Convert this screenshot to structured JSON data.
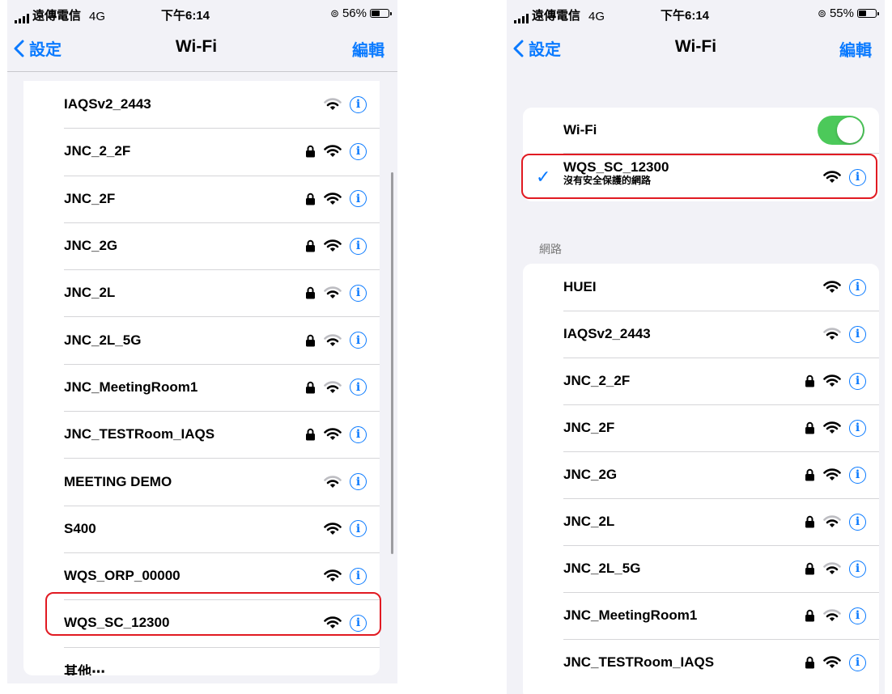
{
  "left": {
    "status": {
      "carrier": "遠傳電信",
      "network": "4G",
      "time": "下午6:14",
      "battery": "56%",
      "battery_level": 0.56
    },
    "nav": {
      "back": "設定",
      "title": "Wi-Fi",
      "edit": "編輯"
    },
    "networks": [
      {
        "name": "IAQSv2_2443",
        "locked": false,
        "signal": "medium"
      },
      {
        "name": "JNC_2_2F",
        "locked": true,
        "signal": "strong"
      },
      {
        "name": "JNC_2F",
        "locked": true,
        "signal": "strong"
      },
      {
        "name": "JNC_2G",
        "locked": true,
        "signal": "strong"
      },
      {
        "name": "JNC_2L",
        "locked": true,
        "signal": "medium"
      },
      {
        "name": "JNC_2L_5G",
        "locked": true,
        "signal": "medium"
      },
      {
        "name": "JNC_MeetingRoom1",
        "locked": true,
        "signal": "medium"
      },
      {
        "name": "JNC_TESTRoom_IAQS",
        "locked": true,
        "signal": "strong"
      },
      {
        "name": "MEETING DEMO",
        "locked": false,
        "signal": "medium"
      },
      {
        "name": "S400",
        "locked": false,
        "signal": "strong"
      },
      {
        "name": "WQS_ORP_00000",
        "locked": false,
        "signal": "strong"
      },
      {
        "name": "WQS_SC_12300",
        "locked": false,
        "signal": "strong"
      }
    ],
    "other": "其他⋯"
  },
  "right": {
    "status": {
      "carrier": "遠傳電信",
      "network": "4G",
      "time": "下午6:14",
      "battery": "55%",
      "battery_level": 0.55
    },
    "nav": {
      "back": "設定",
      "title": "Wi-Fi",
      "edit": "編輯"
    },
    "wifi_label": "Wi-Fi",
    "wifi_on": true,
    "connected": {
      "name": "WQS_SC_12300",
      "subtitle": "沒有安全保護的網路",
      "signal": "strong"
    },
    "section_title": "網路",
    "networks": [
      {
        "name": "HUEI",
        "locked": false,
        "signal": "strong"
      },
      {
        "name": "IAQSv2_2443",
        "locked": false,
        "signal": "medium"
      },
      {
        "name": "JNC_2_2F",
        "locked": true,
        "signal": "strong"
      },
      {
        "name": "JNC_2F",
        "locked": true,
        "signal": "strong"
      },
      {
        "name": "JNC_2G",
        "locked": true,
        "signal": "strong"
      },
      {
        "name": "JNC_2L",
        "locked": true,
        "signal": "medium"
      },
      {
        "name": "JNC_2L_5G",
        "locked": true,
        "signal": "medium"
      },
      {
        "name": "JNC_MeetingRoom1",
        "locked": true,
        "signal": "medium"
      },
      {
        "name": "JNC_TESTRoom_IAQS",
        "locked": true,
        "signal": "strong"
      }
    ]
  },
  "colors": {
    "accent": "#0a7aff",
    "highlight": "#e11a22",
    "toggle_on": "#4cc95a",
    "background": "#f2f2f7"
  },
  "icons": {
    "lock": "lock-icon",
    "wifi": "wifi-icon",
    "info": "info-icon",
    "back": "chevron-left-icon",
    "check": "checkmark-icon",
    "signal": "signal-bars-icon",
    "location": "location-icon",
    "battery": "battery-icon"
  }
}
